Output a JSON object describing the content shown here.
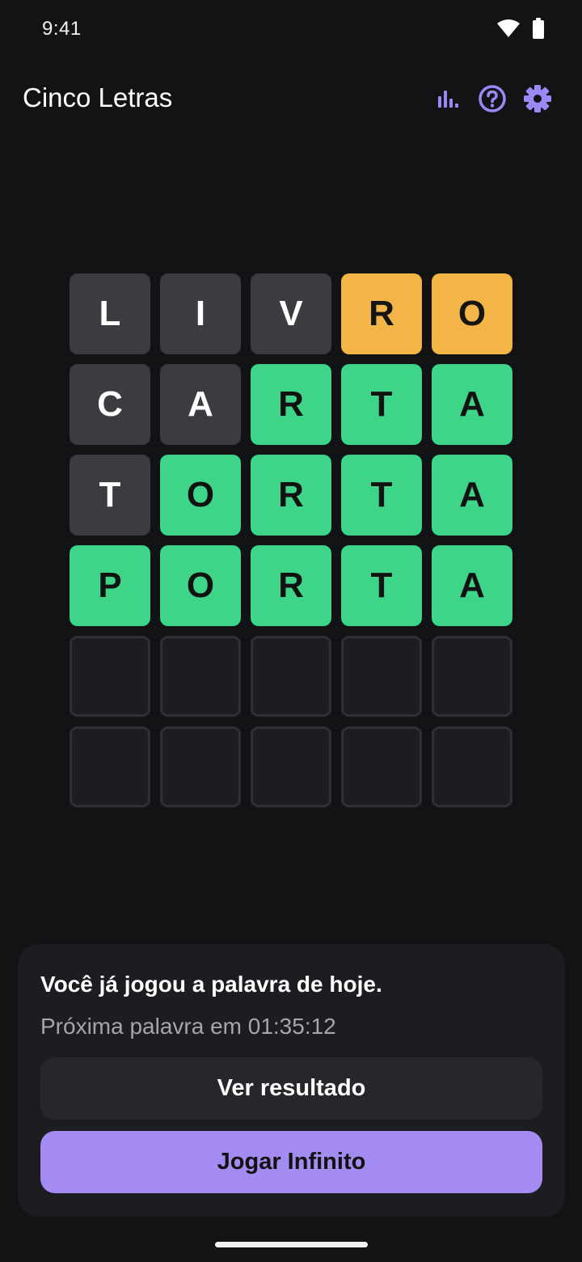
{
  "status_bar": {
    "time": "9:41",
    "icons": [
      "wifi-icon",
      "battery-icon"
    ]
  },
  "app_bar": {
    "title": "Cinco Letras",
    "actions": [
      "stats-icon",
      "help-icon",
      "settings-icon"
    ],
    "accent_color": "#9b87f5"
  },
  "board": {
    "rows": [
      [
        {
          "letter": "L",
          "state": "absent"
        },
        {
          "letter": "I",
          "state": "absent"
        },
        {
          "letter": "V",
          "state": "absent"
        },
        {
          "letter": "R",
          "state": "present"
        },
        {
          "letter": "O",
          "state": "present"
        }
      ],
      [
        {
          "letter": "C",
          "state": "absent"
        },
        {
          "letter": "A",
          "state": "absent"
        },
        {
          "letter": "R",
          "state": "correct"
        },
        {
          "letter": "T",
          "state": "correct"
        },
        {
          "letter": "A",
          "state": "correct"
        }
      ],
      [
        {
          "letter": "T",
          "state": "absent"
        },
        {
          "letter": "O",
          "state": "correct"
        },
        {
          "letter": "R",
          "state": "correct"
        },
        {
          "letter": "T",
          "state": "correct"
        },
        {
          "letter": "A",
          "state": "correct"
        }
      ],
      [
        {
          "letter": "P",
          "state": "correct"
        },
        {
          "letter": "O",
          "state": "correct"
        },
        {
          "letter": "R",
          "state": "correct"
        },
        {
          "letter": "T",
          "state": "correct"
        },
        {
          "letter": "A",
          "state": "correct"
        }
      ],
      [
        {
          "letter": "",
          "state": "empty"
        },
        {
          "letter": "",
          "state": "empty"
        },
        {
          "letter": "",
          "state": "empty"
        },
        {
          "letter": "",
          "state": "empty"
        },
        {
          "letter": "",
          "state": "empty"
        }
      ],
      [
        {
          "letter": "",
          "state": "empty"
        },
        {
          "letter": "",
          "state": "empty"
        },
        {
          "letter": "",
          "state": "empty"
        },
        {
          "letter": "",
          "state": "empty"
        },
        {
          "letter": "",
          "state": "empty"
        }
      ]
    ],
    "colors": {
      "absent": "#3a3c40",
      "present": "#f4b548",
      "correct": "#3ed589",
      "empty": "#1c1d20"
    }
  },
  "sheet": {
    "title": "Você já jogou a palavra de hoje.",
    "subtitle": "Próxima palavra em 01:35:12",
    "secondary_button": "Ver resultado",
    "primary_button": "Jogar Infinito",
    "primary_color": "#a38bf1"
  }
}
